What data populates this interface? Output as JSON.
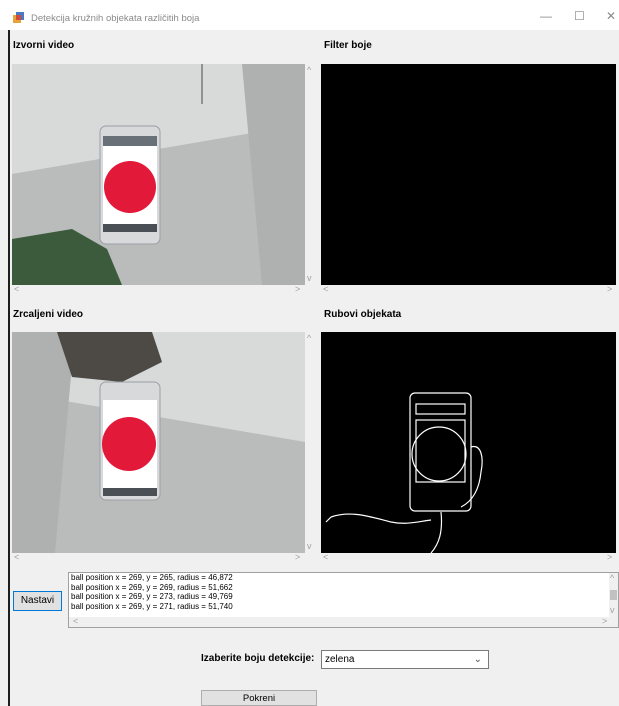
{
  "window": {
    "title": "Detekcija kružnih objekata različitih boja",
    "controls": {
      "minimize": "—",
      "maximize": "☐",
      "close": "✕"
    }
  },
  "panels": {
    "source_video": {
      "label": "Izvorni video"
    },
    "color_filter": {
      "label": "Filter boje"
    },
    "mirrored_video": {
      "label": "Zrcaljeni video"
    },
    "object_edges": {
      "label": "Rubovi objekata"
    }
  },
  "scroll_glyphs": {
    "up": "^",
    "down": "v",
    "left": "<",
    "right": ">"
  },
  "log": {
    "continue_button": "Nastavi",
    "lines": [
      "ball position x =  269, y =  265, radius =  46,872",
      "ball position x =  269, y =  269, radius =  51,662",
      "ball position x =  269, y =  273, radius =  49,769",
      "ball position x =  269, y =  271, radius =  51,740"
    ]
  },
  "color_select": {
    "label": "Izaberite boju  detekcije:",
    "value": "zelena"
  },
  "start_button": "Pokreni",
  "colors": {
    "ball": "#e3193a",
    "accent": "#0078d7",
    "video_background": "#000000"
  }
}
